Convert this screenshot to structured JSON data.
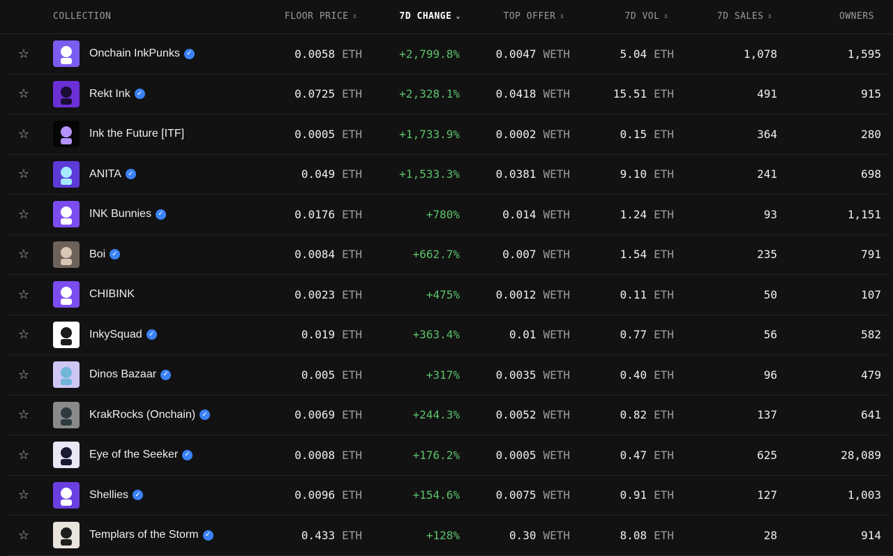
{
  "headers": {
    "collection": "COLLECTION",
    "floor": "FLOOR PRICE",
    "change": "7D CHANGE",
    "offer": "TOP OFFER",
    "vol": "7D VOL",
    "sales": "7D SALES",
    "owners": "OWNERS"
  },
  "icons": {
    "star": "star-outline-icon",
    "verified": "verified-badge-icon",
    "sort": "sort-arrows-icon",
    "sort_active": "chevron-down-icon"
  },
  "colors": {
    "positive": "#5cc26a",
    "verified": "#3b82f6",
    "background": "#121212"
  },
  "rows": [
    {
      "name": "Onchain InkPunks",
      "verified": true,
      "floor": "0.0058",
      "floor_unit": "ETH",
      "change": "+2,799.8%",
      "offer": "0.0047",
      "offer_unit": "WETH",
      "vol": "5.04",
      "vol_unit": "ETH",
      "sales": "1,078",
      "owners": "1,595",
      "thumb_bg": "#7b5cf0",
      "thumb_fg": "#ffffff"
    },
    {
      "name": "Rekt Ink",
      "verified": true,
      "floor": "0.0725",
      "floor_unit": "ETH",
      "change": "+2,328.1%",
      "offer": "0.0418",
      "offer_unit": "WETH",
      "vol": "15.51",
      "vol_unit": "ETH",
      "sales": "491",
      "owners": "915",
      "thumb_bg": "#6b2fd6",
      "thumb_fg": "#1a0d33"
    },
    {
      "name": "Ink the Future [ITF]",
      "verified": false,
      "floor": "0.0005",
      "floor_unit": "ETH",
      "change": "+1,733.9%",
      "offer": "0.0002",
      "offer_unit": "WETH",
      "vol": "0.15",
      "vol_unit": "ETH",
      "sales": "364",
      "owners": "280",
      "thumb_bg": "#050505",
      "thumb_fg": "#b593ff"
    },
    {
      "name": "ANITA",
      "verified": true,
      "floor": "0.049",
      "floor_unit": "ETH",
      "change": "+1,533.3%",
      "offer": "0.0381",
      "offer_unit": "WETH",
      "vol": "9.10",
      "vol_unit": "ETH",
      "sales": "241",
      "owners": "698",
      "thumb_bg": "#5b3ad8",
      "thumb_fg": "#a6e9ff"
    },
    {
      "name": "INK Bunnies",
      "verified": true,
      "floor": "0.0176",
      "floor_unit": "ETH",
      "change": "+780%",
      "offer": "0.014",
      "offer_unit": "WETH",
      "vol": "1.24",
      "vol_unit": "ETH",
      "sales": "93",
      "owners": "1,151",
      "thumb_bg": "#7b4df0",
      "thumb_fg": "#ffffff"
    },
    {
      "name": "Boi",
      "verified": true,
      "floor": "0.0084",
      "floor_unit": "ETH",
      "change": "+662.7%",
      "offer": "0.007",
      "offer_unit": "WETH",
      "vol": "1.54",
      "vol_unit": "ETH",
      "sales": "235",
      "owners": "791",
      "thumb_bg": "#6d625a",
      "thumb_fg": "#d8c7b5"
    },
    {
      "name": "CHIBINK",
      "verified": false,
      "floor": "0.0023",
      "floor_unit": "ETH",
      "change": "+475%",
      "offer": "0.0012",
      "offer_unit": "WETH",
      "vol": "0.11",
      "vol_unit": "ETH",
      "sales": "50",
      "owners": "107",
      "thumb_bg": "#7b4df0",
      "thumb_fg": "#ffffff"
    },
    {
      "name": "InkySquad",
      "verified": true,
      "floor": "0.019",
      "floor_unit": "ETH",
      "change": "+363.4%",
      "offer": "0.01",
      "offer_unit": "WETH",
      "vol": "0.77",
      "vol_unit": "ETH",
      "sales": "56",
      "owners": "582",
      "thumb_bg": "#ffffff",
      "thumb_fg": "#1b1b1b"
    },
    {
      "name": "Dinos Bazaar",
      "verified": true,
      "floor": "0.005",
      "floor_unit": "ETH",
      "change": "+317%",
      "offer": "0.0035",
      "offer_unit": "WETH",
      "vol": "0.40",
      "vol_unit": "ETH",
      "sales": "96",
      "owners": "479",
      "thumb_bg": "#cfc6f4",
      "thumb_fg": "#6fb6d8"
    },
    {
      "name": "KrakRocks (Onchain)",
      "verified": true,
      "floor": "0.0069",
      "floor_unit": "ETH",
      "change": "+244.3%",
      "offer": "0.0052",
      "offer_unit": "WETH",
      "vol": "0.82",
      "vol_unit": "ETH",
      "sales": "137",
      "owners": "641",
      "thumb_bg": "#8a8a8a",
      "thumb_fg": "#2e3b3e"
    },
    {
      "name": "Eye of the Seeker",
      "verified": true,
      "floor": "0.0008",
      "floor_unit": "ETH",
      "change": "+176.2%",
      "offer": "0.0005",
      "offer_unit": "WETH",
      "vol": "0.47",
      "vol_unit": "ETH",
      "sales": "625",
      "owners": "28,089",
      "thumb_bg": "#e9e6f5",
      "thumb_fg": "#1a1a33"
    },
    {
      "name": "Shellies",
      "verified": true,
      "floor": "0.0096",
      "floor_unit": "ETH",
      "change": "+154.6%",
      "offer": "0.0075",
      "offer_unit": "WETH",
      "vol": "0.91",
      "vol_unit": "ETH",
      "sales": "127",
      "owners": "1,003",
      "thumb_bg": "#6a3fe0",
      "thumb_fg": "#ffffff"
    },
    {
      "name": "Templars of the Storm",
      "verified": true,
      "floor": "0.433",
      "floor_unit": "ETH",
      "change": "+128%",
      "offer": "0.30",
      "offer_unit": "WETH",
      "vol": "8.08",
      "vol_unit": "ETH",
      "sales": "28",
      "owners": "914",
      "thumb_bg": "#e8e4dc",
      "thumb_fg": "#1e1e1e"
    }
  ]
}
